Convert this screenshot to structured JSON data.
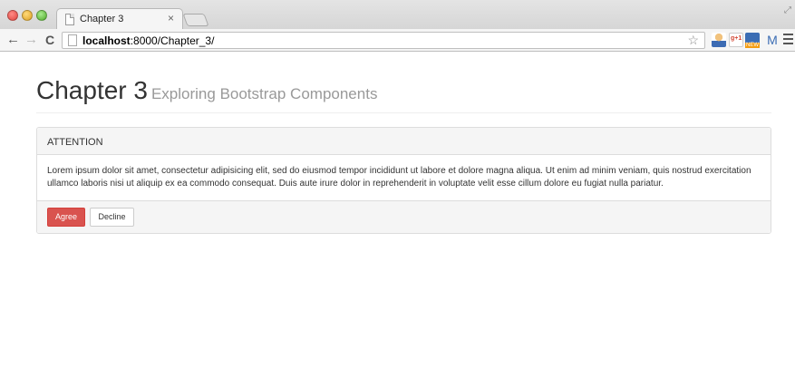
{
  "browser": {
    "tab_title": "Chapter 3",
    "tab_close": "×",
    "url_host": "localhost",
    "url_rest": ":8000/Chapter_3/",
    "icons": [
      "close-window-icon",
      "minimize-window-icon",
      "zoom-window-icon",
      "page-icon",
      "back-arrow-icon",
      "forward-arrow-icon",
      "reload-icon",
      "bookmark-star-icon",
      "extension-person-icon",
      "google-plus-icon",
      "new-badge-icon",
      "gmail-icon",
      "menu-icon",
      "fullscreen-icon"
    ]
  },
  "page": {
    "title": "Chapter 3",
    "subtitle": "Exploring Bootstrap Components"
  },
  "panel": {
    "heading": "ATTENTION",
    "body": "Lorem ipsum dolor sit amet, consectetur adipisicing elit, sed do eiusmod tempor incididunt ut labore et dolore magna aliqua. Ut enim ad minim veniam, quis nostrud exercitation ullamco laboris nisi ut aliquip ex ea commodo consequat. Duis aute irure dolor in reprehenderit in voluptate velit esse cillum dolore eu fugiat nulla pariatur.",
    "agree_label": "Agree",
    "decline_label": "Decline"
  },
  "colors": {
    "danger": "#d9534f",
    "panel_bg": "#f5f5f5",
    "border": "#dddddd"
  }
}
